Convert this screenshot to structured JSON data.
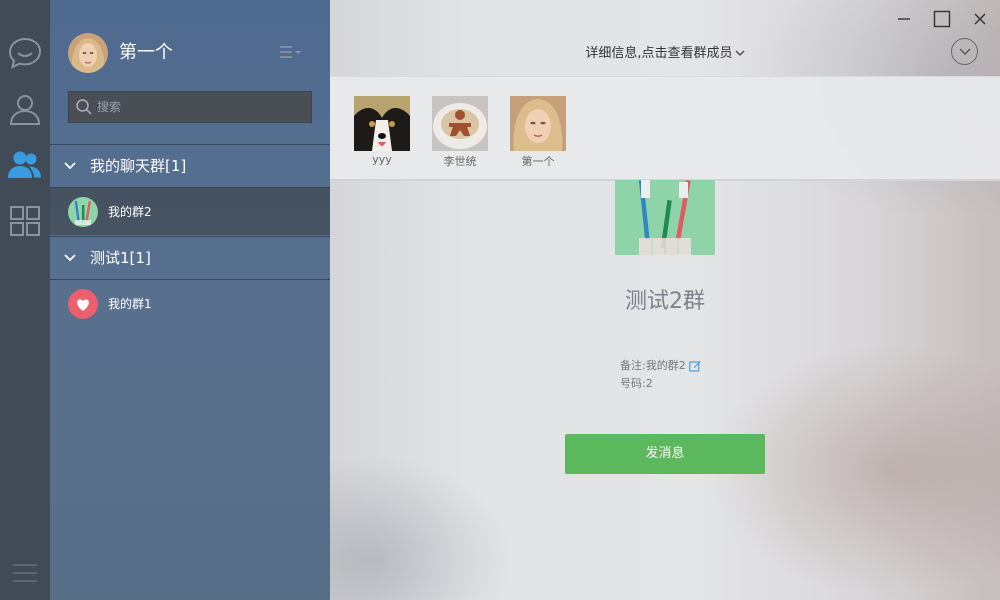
{
  "window": {
    "minimize_label": "minimize",
    "maximize_label": "maximize",
    "close_label": "close"
  },
  "sidebar": {
    "icons": [
      "chat-bubble-icon",
      "contact-person-icon",
      "group-people-icon",
      "apps-grid-icon",
      "hamburger-menu-icon"
    ],
    "active_icon": "group-people-icon",
    "accent": "#3a9be0"
  },
  "profile": {
    "name": "第一个"
  },
  "search": {
    "placeholder": "搜索",
    "value": ""
  },
  "groups": [
    {
      "label": "我的聊天群[1]",
      "items": [
        {
          "name": "我的群2",
          "selected": true
        }
      ]
    },
    {
      "label": "测试1[1]",
      "items": [
        {
          "name": "我的群1",
          "selected": false
        }
      ]
    }
  ],
  "header": {
    "title": "详细信息,点击查看群成员"
  },
  "members": [
    {
      "name": "yyy"
    },
    {
      "name": "李世统"
    },
    {
      "name": "第一个"
    }
  ],
  "detail": {
    "group_name": "测试2群",
    "remark_label": "备注:",
    "remark_value": "我的群2",
    "number_label": "号码:",
    "number_value": "2",
    "send_label": "发消息"
  },
  "colors": {
    "send_button": "#5cb85c",
    "panel": "#55708f",
    "rail": "#414b57"
  }
}
